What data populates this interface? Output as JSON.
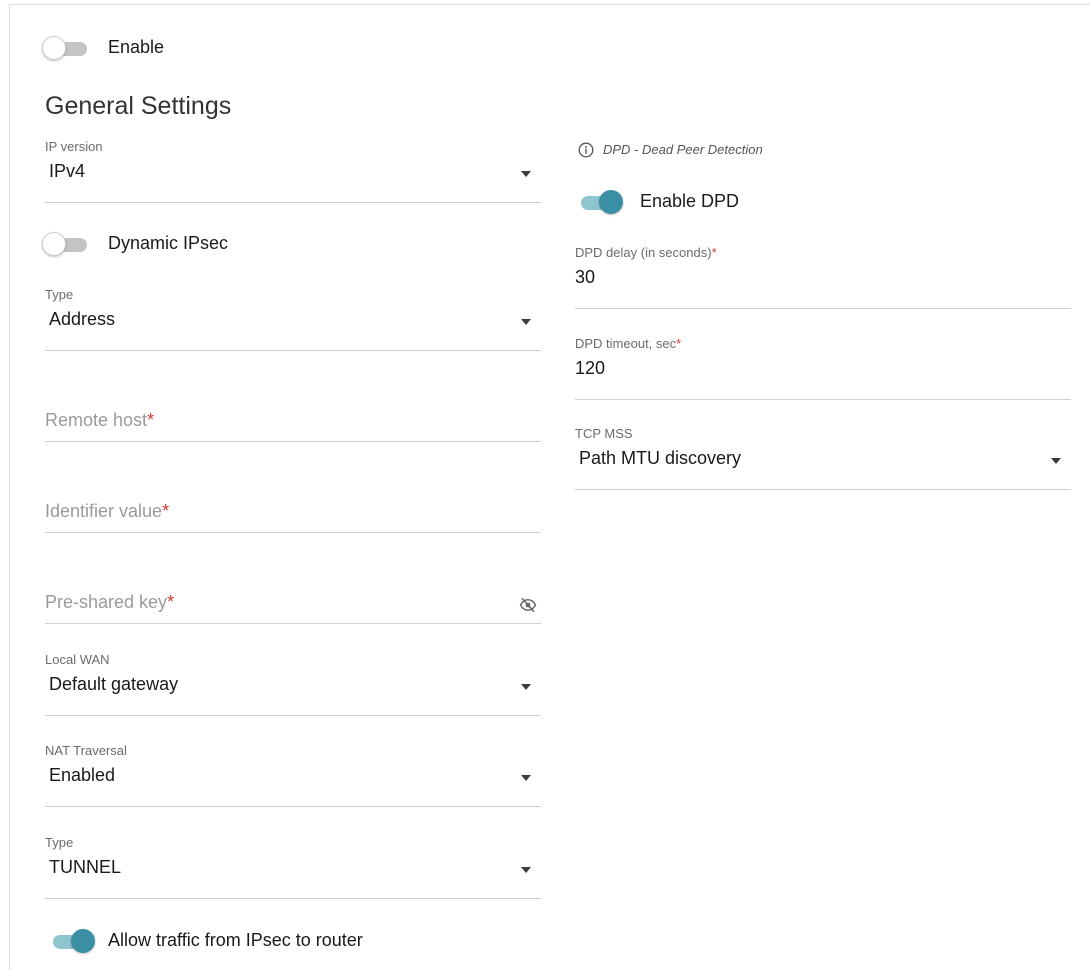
{
  "enable": {
    "label": "Enable",
    "on": false
  },
  "general": {
    "heading": "General Settings"
  },
  "left": {
    "ip_version": {
      "label": "IP version",
      "value": "IPv4"
    },
    "dynamic_ipsec": {
      "label": "Dynamic IPsec",
      "on": false
    },
    "type1": {
      "label": "Type",
      "value": "Address"
    },
    "remote_host": {
      "placeholder": "Remote host",
      "required": "*"
    },
    "identifier_value": {
      "placeholder": "Identifier value",
      "required": "*"
    },
    "pre_shared_key": {
      "placeholder": "Pre-shared key",
      "required": "*",
      "icon": "eye-off-icon"
    },
    "local_wan": {
      "label": "Local WAN",
      "value": "Default gateway"
    },
    "nat_traversal": {
      "label": "NAT Traversal",
      "value": "Enabled"
    },
    "type2": {
      "label": "Type",
      "value": "TUNNEL"
    },
    "allow_traffic": {
      "label": "Allow traffic from IPsec to router",
      "on": true
    }
  },
  "right": {
    "dpd_note": {
      "icon": "info-icon",
      "text": "DPD - Dead Peer Detection"
    },
    "enable_dpd": {
      "label": "Enable DPD",
      "on": true
    },
    "dpd_delay": {
      "label": "DPD delay (in seconds)",
      "required": "*",
      "value": "30"
    },
    "dpd_timeout": {
      "label": "DPD timeout, sec",
      "required": "*",
      "value": "120"
    },
    "tcp_mss": {
      "label": "TCP MSS",
      "value": "Path MTU discovery"
    }
  },
  "colors": {
    "accent": "#3a8fa4",
    "accent_track": "#8fc5cf",
    "required": "#d23c2a"
  }
}
